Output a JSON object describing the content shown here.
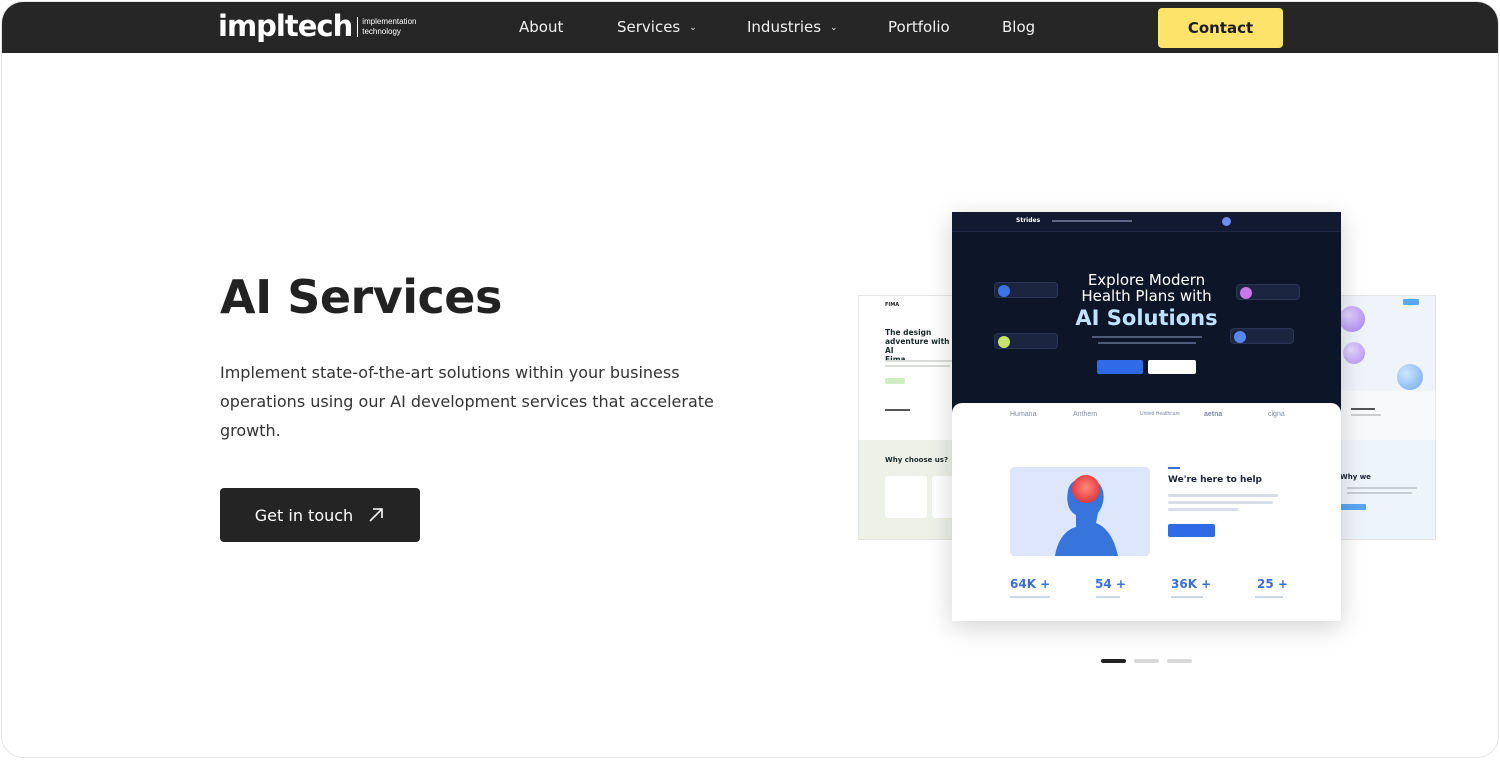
{
  "brand": {
    "name": "impltech",
    "tagline_line1": "implementation",
    "tagline_line2": "technology"
  },
  "nav": {
    "items": [
      {
        "label": "About",
        "has_dropdown": false
      },
      {
        "label": "Services",
        "has_dropdown": true
      },
      {
        "label": "Industries",
        "has_dropdown": true
      },
      {
        "label": "Portfolio",
        "has_dropdown": false
      },
      {
        "label": "Blog",
        "has_dropdown": false
      }
    ],
    "contact_label": "Contact"
  },
  "hero": {
    "title": "AI Services",
    "description": "Implement state-of-the-art solutions within your business operations using our AI development services that accelerate growth.",
    "cta_label": "Get in touch"
  },
  "showcase": {
    "main": {
      "nav_brand": "Strides",
      "hero_line1": "Explore Modern",
      "hero_line2": "Health Plans with",
      "hero_accent": "AI Solutions",
      "brands": [
        "Humana",
        "Anthem",
        "United Healthcare",
        "aetna",
        "cigna"
      ],
      "help_title": "We're here to help",
      "stats": [
        "64K +",
        "54 +",
        "36K +",
        "25 +"
      ]
    },
    "left": {
      "brand": "FIMA",
      "title_line1": "The design",
      "title_line2": "adventure with AI",
      "title_line3": "Fima",
      "section_title": "Why choose us?"
    },
    "right": {
      "section_title": "Why we"
    }
  },
  "carousel": {
    "slides": 3,
    "active": 0
  },
  "colors": {
    "nav_bg": "#262626",
    "contact_bg": "#fde36a",
    "cta_bg": "#242424",
    "accent_blue": "#3a6fd8"
  }
}
